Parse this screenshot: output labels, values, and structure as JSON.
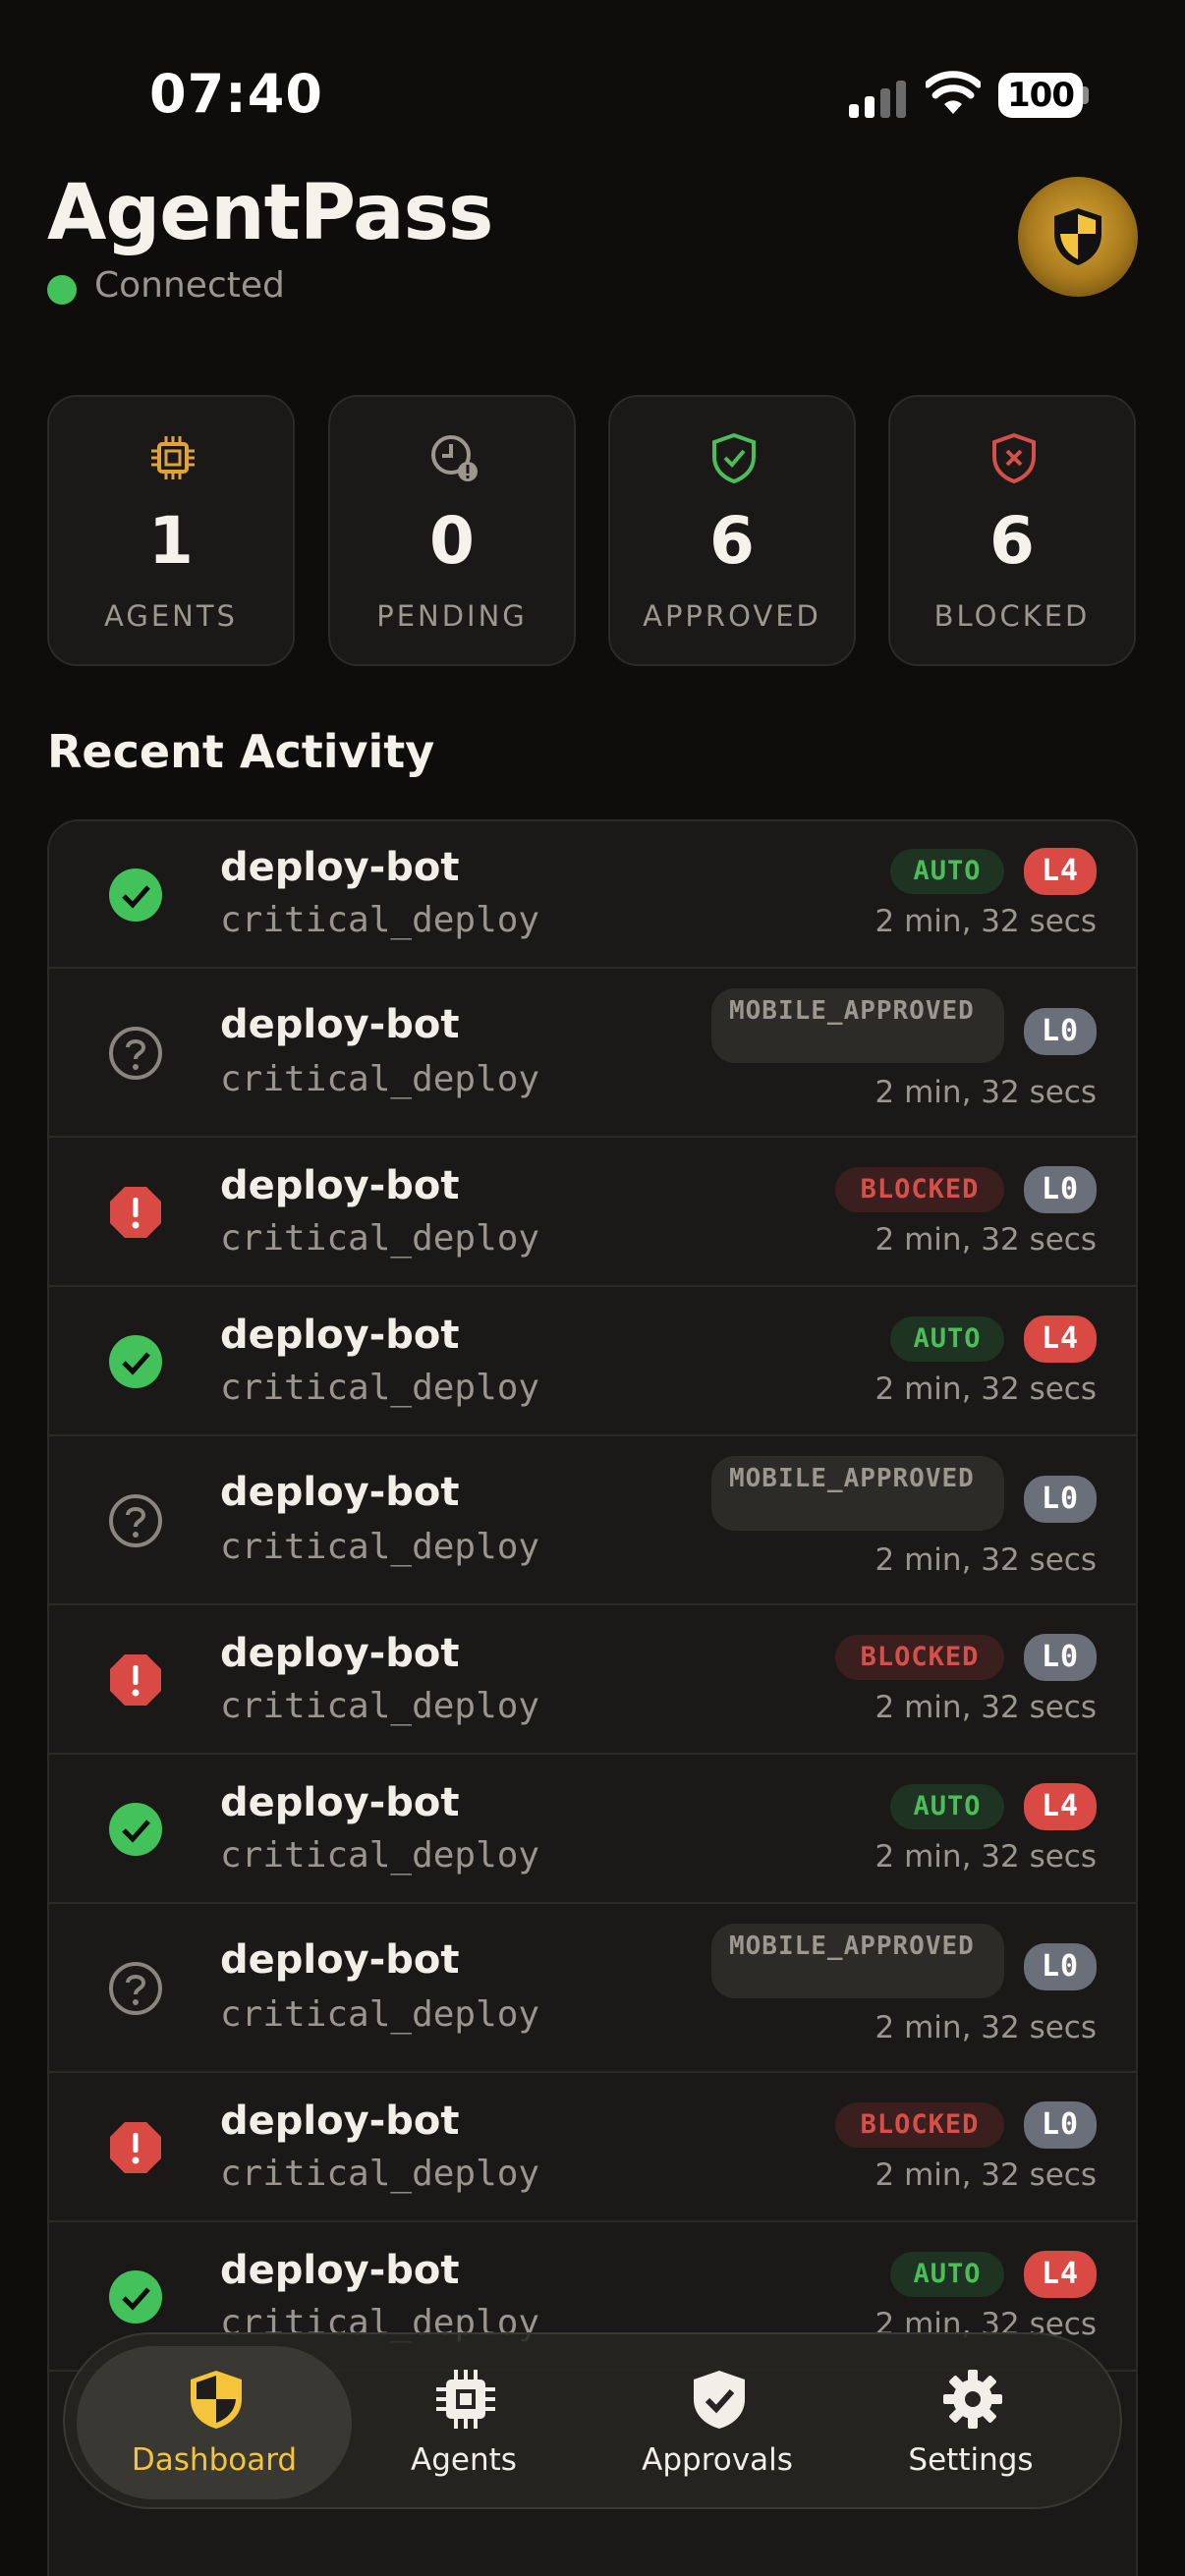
{
  "status_bar": {
    "time": "07:40",
    "battery": "100"
  },
  "header": {
    "title": "AgentPass",
    "connection": "Connected"
  },
  "stats": [
    {
      "value": "1",
      "label": "AGENTS",
      "icon": "chip-icon",
      "color": "#e0a23a"
    },
    {
      "value": "0",
      "label": "PENDING",
      "icon": "clock-alert-icon",
      "color": "#9c978f"
    },
    {
      "value": "6",
      "label": "APPROVED",
      "icon": "shield-check-icon",
      "color": "#4cbd5a"
    },
    {
      "value": "6",
      "label": "BLOCKED",
      "icon": "shield-x-icon",
      "color": "#d5504a"
    }
  ],
  "recent": {
    "title": "Recent Activity",
    "rows": [
      {
        "agent": "deploy-bot",
        "tool": "critical_deploy",
        "status": "AUTO",
        "level": "L4",
        "time": "2 min, 32 secs"
      },
      {
        "agent": "deploy-bot",
        "tool": "critical_deploy",
        "status": "MOBILE_APPROVED",
        "level": "L0",
        "time": "2 min, 32 secs"
      },
      {
        "agent": "deploy-bot",
        "tool": "critical_deploy",
        "status": "BLOCKED",
        "level": "L0",
        "time": "2 min, 32 secs"
      },
      {
        "agent": "deploy-bot",
        "tool": "critical_deploy",
        "status": "AUTO",
        "level": "L4",
        "time": "2 min, 32 secs"
      },
      {
        "agent": "deploy-bot",
        "tool": "critical_deploy",
        "status": "MOBILE_APPROVED",
        "level": "L0",
        "time": "2 min, 32 secs"
      },
      {
        "agent": "deploy-bot",
        "tool": "critical_deploy",
        "status": "BLOCKED",
        "level": "L0",
        "time": "2 min, 32 secs"
      },
      {
        "agent": "deploy-bot",
        "tool": "critical_deploy",
        "status": "AUTO",
        "level": "L4",
        "time": "2 min, 32 secs"
      },
      {
        "agent": "deploy-bot",
        "tool": "critical_deploy",
        "status": "MOBILE_APPROVED",
        "level": "L0",
        "time": "2 min, 32 secs"
      },
      {
        "agent": "deploy-bot",
        "tool": "critical_deploy",
        "status": "BLOCKED",
        "level": "L0",
        "time": "2 min, 32 secs"
      },
      {
        "agent": "deploy-bot",
        "tool": "critical_deploy",
        "status": "AUTO",
        "level": "L4",
        "time": "2 min, 32 secs"
      }
    ]
  },
  "tabs": [
    {
      "label": "Dashboard",
      "icon": "shield-icon",
      "active": true
    },
    {
      "label": "Agents",
      "icon": "chip-icon",
      "active": false
    },
    {
      "label": "Approvals",
      "icon": "shield-check-icon",
      "active": false
    },
    {
      "label": "Settings",
      "icon": "gear-icon",
      "active": false
    }
  ]
}
